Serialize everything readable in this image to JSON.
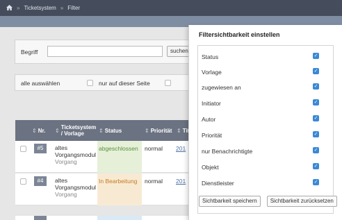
{
  "breadcrumb": {
    "items": [
      "Ticketsystem",
      "Filter"
    ]
  },
  "filter": {
    "label": "Begriff",
    "search_button": "suchen",
    "more_glyph": "+"
  },
  "selection": {
    "select_all": "alle auswählen",
    "only_this_page": "nur auf dieser Seite"
  },
  "table": {
    "headers": {
      "nr": "Nr.",
      "template": "Ticketsystem / Vorlage",
      "status": "Status",
      "priority": "Priorität",
      "title": "Tit"
    },
    "rows": [
      {
        "nr": "#5",
        "template_line1": "altes",
        "template_line2": "Vorgangsmodul",
        "template_sub": "Vorgang",
        "status": "abgeschlossen",
        "priority": "normal",
        "date": "201"
      },
      {
        "nr": "#4",
        "template_line1": "altes",
        "template_line2": "Vorgangsmodul",
        "template_sub": "Vorgang",
        "status": "In Bearbeitung",
        "priority": "normal",
        "date": "201"
      }
    ]
  },
  "dialog": {
    "title": "Filtersichtbarkeit einstellen",
    "items": [
      {
        "label": "Status",
        "checked": true
      },
      {
        "label": "Vorlage",
        "checked": true
      },
      {
        "label": "zugewiesen an",
        "checked": true
      },
      {
        "label": "Initiator",
        "checked": true
      },
      {
        "label": "Autor",
        "checked": true
      },
      {
        "label": "Priorität",
        "checked": true
      },
      {
        "label": "nur Benachrichtigte",
        "checked": true
      },
      {
        "label": "Objekt",
        "checked": true
      },
      {
        "label": "Dienstleister",
        "checked": true
      }
    ],
    "save_button": "Sichtbarkeit speichern",
    "reset_button": "Sichtbarkeit zurücksetzen"
  },
  "colors": {
    "topbar": "#454d5c",
    "subbar": "#7f8da3",
    "table_header": "#6b7281",
    "checkbox_checked": "#3b88d7",
    "status_done": "#5a8f3b",
    "status_in_progress": "#c37a26"
  },
  "icons": {
    "home": "home-icon",
    "breadcrumb_separator": "chevron-right-icon",
    "check": "checkmark-icon"
  }
}
